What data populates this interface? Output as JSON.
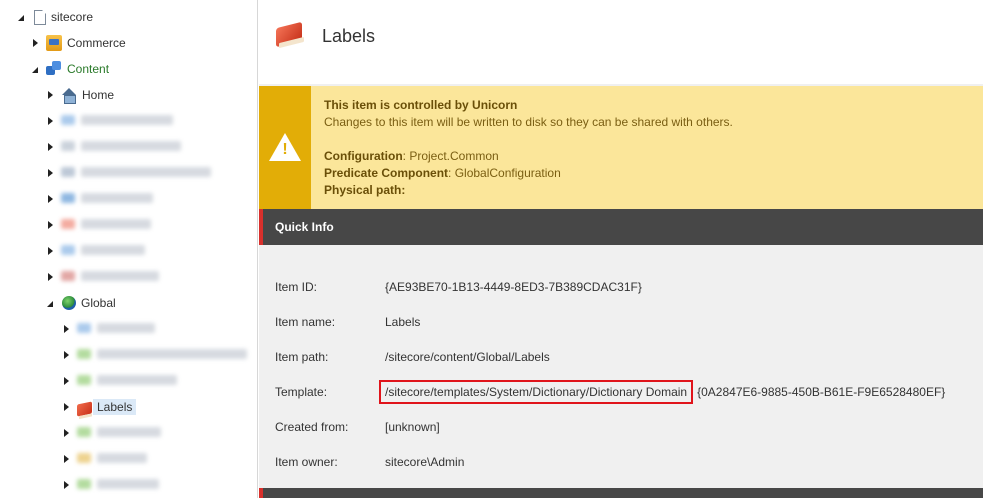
{
  "tree": {
    "root": "sitecore",
    "commerce": "Commerce",
    "content": "Content",
    "home": "Home",
    "global": "Global",
    "labels": "Labels"
  },
  "header": {
    "title": "Labels"
  },
  "unicorn": {
    "heading": "This item is controlled by Unicorn",
    "message": "Changes to this item will be written to disk so they can be shared with others.",
    "configuration_label": "Configuration",
    "configuration_value": "Project.Common",
    "predicate_label": "Predicate Component",
    "predicate_value": "GlobalConfiguration",
    "physical_path_label": "Physical path:"
  },
  "quick_info": {
    "title": "Quick Info",
    "item_id_label": "Item ID:",
    "item_id": "{AE93BE70-1B13-4449-8ED3-7B389CDAC31F}",
    "item_name_label": "Item name:",
    "item_name": "Labels",
    "item_path_label": "Item path:",
    "item_path": "/sitecore/content/Global/Labels",
    "template_label": "Template:",
    "template_path": "/sitecore/templates/System/Dictionary/Dictionary Domain",
    "template_id": "{0A2847E6-9885-450B-B61E-F9E6528480EF}",
    "created_from_label": "Created from:",
    "created_from": "[unknown]",
    "item_owner_label": "Item owner:",
    "item_owner": "sitecore\\Admin"
  },
  "colors": {
    "warning_bg": "#fbe69a",
    "warning_side": "#e2ad07",
    "section_bar": "#474747",
    "accent_red": "#d9302c",
    "highlight_box": "#e0141b"
  }
}
